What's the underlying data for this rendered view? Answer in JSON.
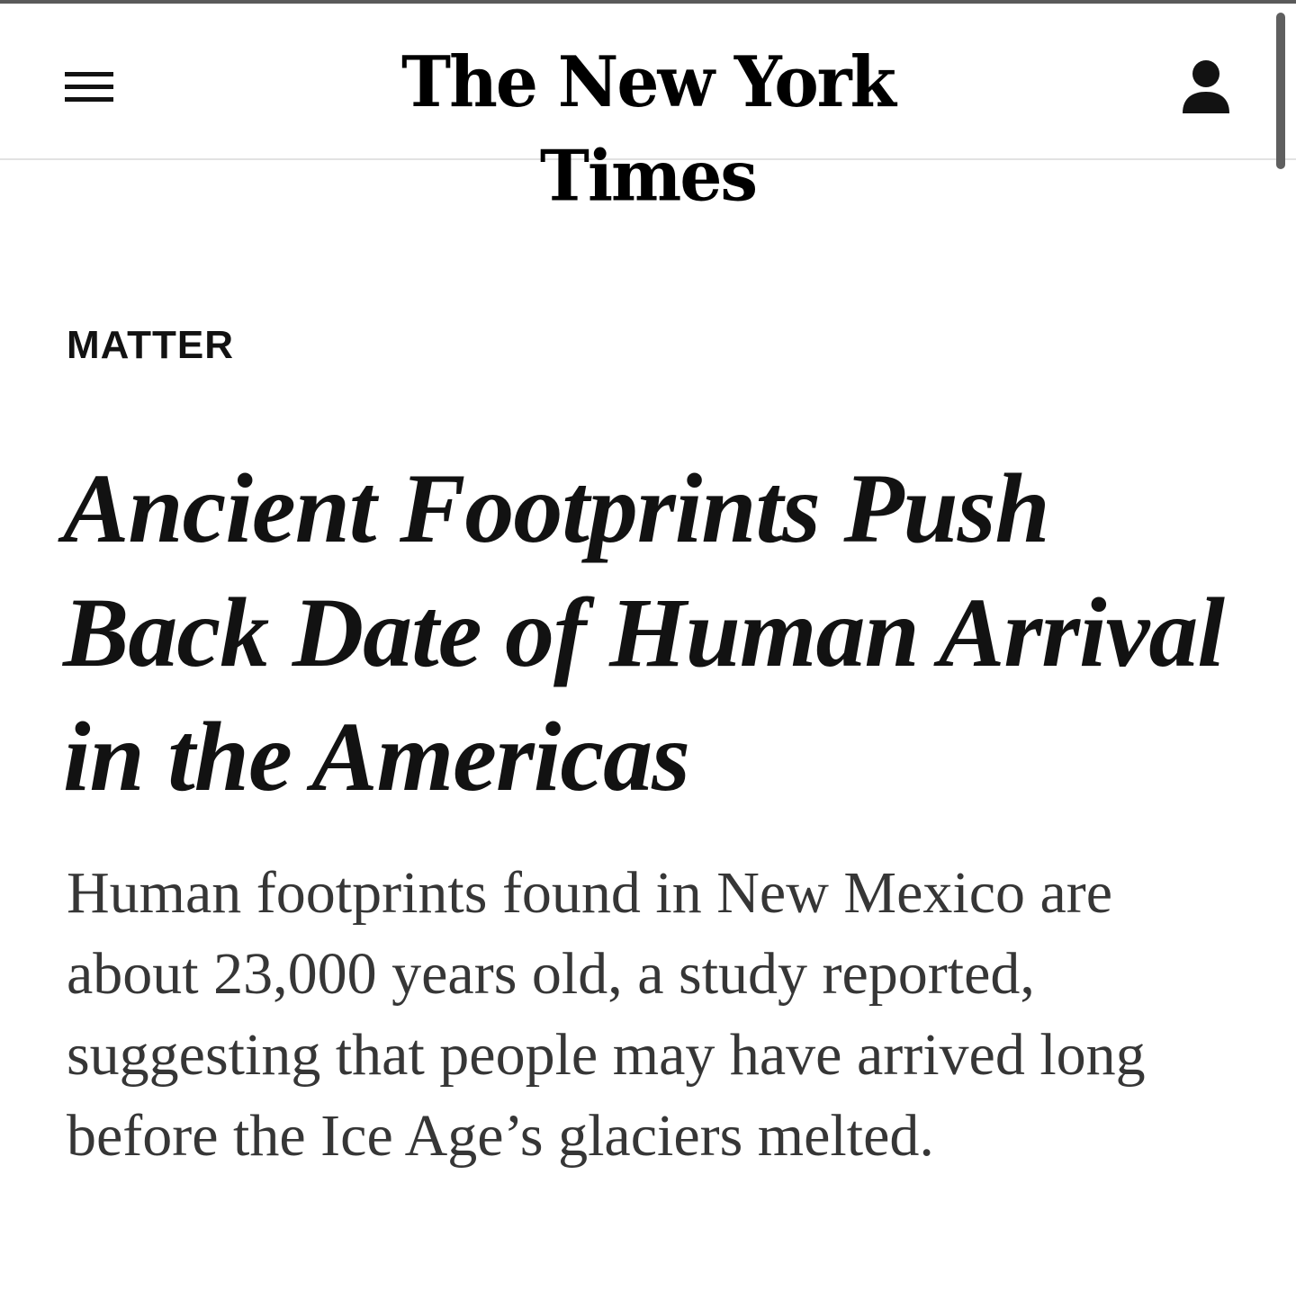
{
  "masthead": {
    "logo_text": "The New York Times",
    "menu_icon": "hamburger-menu-icon",
    "account_icon": "user-account-icon"
  },
  "article": {
    "kicker": "MATTER",
    "headline": "Ancient Footprints Push Back Date of Human Arrival in the Americas",
    "summary": "Human footprints found in New Mexico are about 23,000 years old, a study reported, suggesting that people may have arrived long before the Ice Age’s glaciers melted."
  },
  "colors": {
    "text": "#121212",
    "summary_text": "#363636",
    "divider": "#e2e2e2",
    "background": "#ffffff"
  }
}
